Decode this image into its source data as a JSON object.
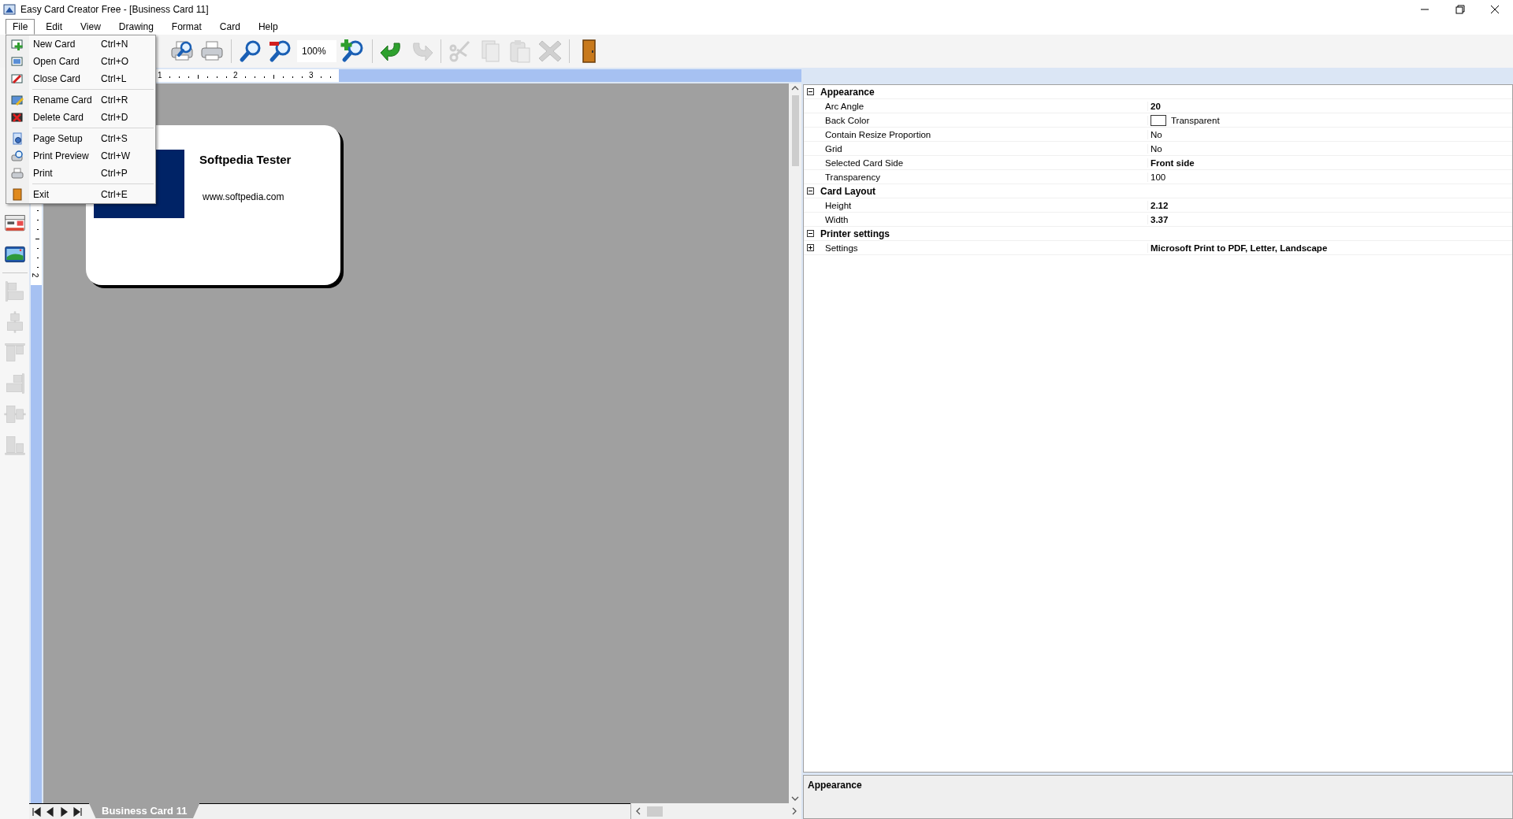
{
  "window": {
    "title": "Easy Card Creator Free - [Business Card 11]"
  },
  "menu_bar": [
    {
      "label": "File",
      "selected": true
    },
    {
      "label": "Edit",
      "selected": false
    },
    {
      "label": "View",
      "selected": false
    },
    {
      "label": "Drawing",
      "selected": false
    },
    {
      "label": "Format",
      "selected": false
    },
    {
      "label": "Card",
      "selected": false
    },
    {
      "label": "Help",
      "selected": false
    }
  ],
  "file_menu": {
    "groups": [
      [
        {
          "label": "New Card",
          "shortcut": "Ctrl+N"
        },
        {
          "label": "Open Card",
          "shortcut": "Ctrl+O"
        },
        {
          "label": "Close Card",
          "shortcut": "Ctrl+L"
        }
      ],
      [
        {
          "label": "Rename Card",
          "shortcut": "Ctrl+R"
        },
        {
          "label": "Delete Card",
          "shortcut": "Ctrl+D"
        }
      ],
      [
        {
          "label": "Page Setup",
          "shortcut": "Ctrl+S"
        },
        {
          "label": "Print Preview",
          "shortcut": "Ctrl+W"
        },
        {
          "label": "Print",
          "shortcut": "Ctrl+P"
        }
      ],
      [
        {
          "label": "Exit",
          "shortcut": "Ctrl+E"
        }
      ]
    ]
  },
  "toolbar": {
    "zoom": "100%",
    "buttons": [
      {
        "disabled": false
      },
      {
        "disabled": false
      },
      {
        "disabled": false
      },
      {
        "disabled": false
      },
      {
        "disabled": false
      },
      {
        "disabled": false
      },
      {
        "disabled": true
      },
      {
        "disabled": true
      },
      {
        "disabled": true
      },
      {
        "disabled": true
      },
      {
        "disabled": true
      },
      {
        "disabled": false
      }
    ]
  },
  "side_toolbar": [
    {
      "disabled": false
    },
    {
      "disabled": false
    },
    {
      "disabled": true
    },
    {
      "disabled": true
    },
    {
      "disabled": true
    },
    {
      "disabled": true
    },
    {
      "disabled": true
    },
    {
      "disabled": true
    }
  ],
  "ruler": {
    "horizontal_labels": [
      "1",
      "2",
      "3"
    ],
    "vertical_labels": [
      "2"
    ]
  },
  "card": {
    "name": "Softpedia Tester",
    "website": "www.softpedia.com"
  },
  "card_tabs": [
    {
      "label": "Business Card 11",
      "selected": true
    }
  ],
  "properties": [
    {
      "category": "Appearance",
      "expanded": true,
      "rows": [
        {
          "kind": "text",
          "name": "Arc Angle",
          "value": "20",
          "modified": true
        },
        {
          "kind": "color",
          "name": "Back Color",
          "value": "Transparent",
          "modified": false
        },
        {
          "kind": "text",
          "name": "Contain Resize Proportion",
          "value": "No",
          "modified": false
        },
        {
          "kind": "text",
          "name": "Grid",
          "value": "No",
          "modified": false
        },
        {
          "kind": "text",
          "name": "Selected Card Side",
          "value": "Front side",
          "modified": true
        },
        {
          "kind": "text",
          "name": "Transparency",
          "value": "100",
          "modified": false
        }
      ]
    },
    {
      "category": "Card Layout",
      "expanded": true,
      "rows": [
        {
          "kind": "text",
          "name": "Height",
          "value": "2.12",
          "modified": true
        },
        {
          "kind": "text",
          "name": "Width",
          "value": "3.37",
          "modified": true
        }
      ]
    },
    {
      "category": "Printer settings",
      "expanded": true,
      "rows": [
        {
          "kind": "group",
          "name": "Settings",
          "value": "Microsoft Print to PDF, Letter, Landscape",
          "modified": true,
          "expanded": false
        }
      ]
    }
  ],
  "help": {
    "title": "Appearance"
  }
}
